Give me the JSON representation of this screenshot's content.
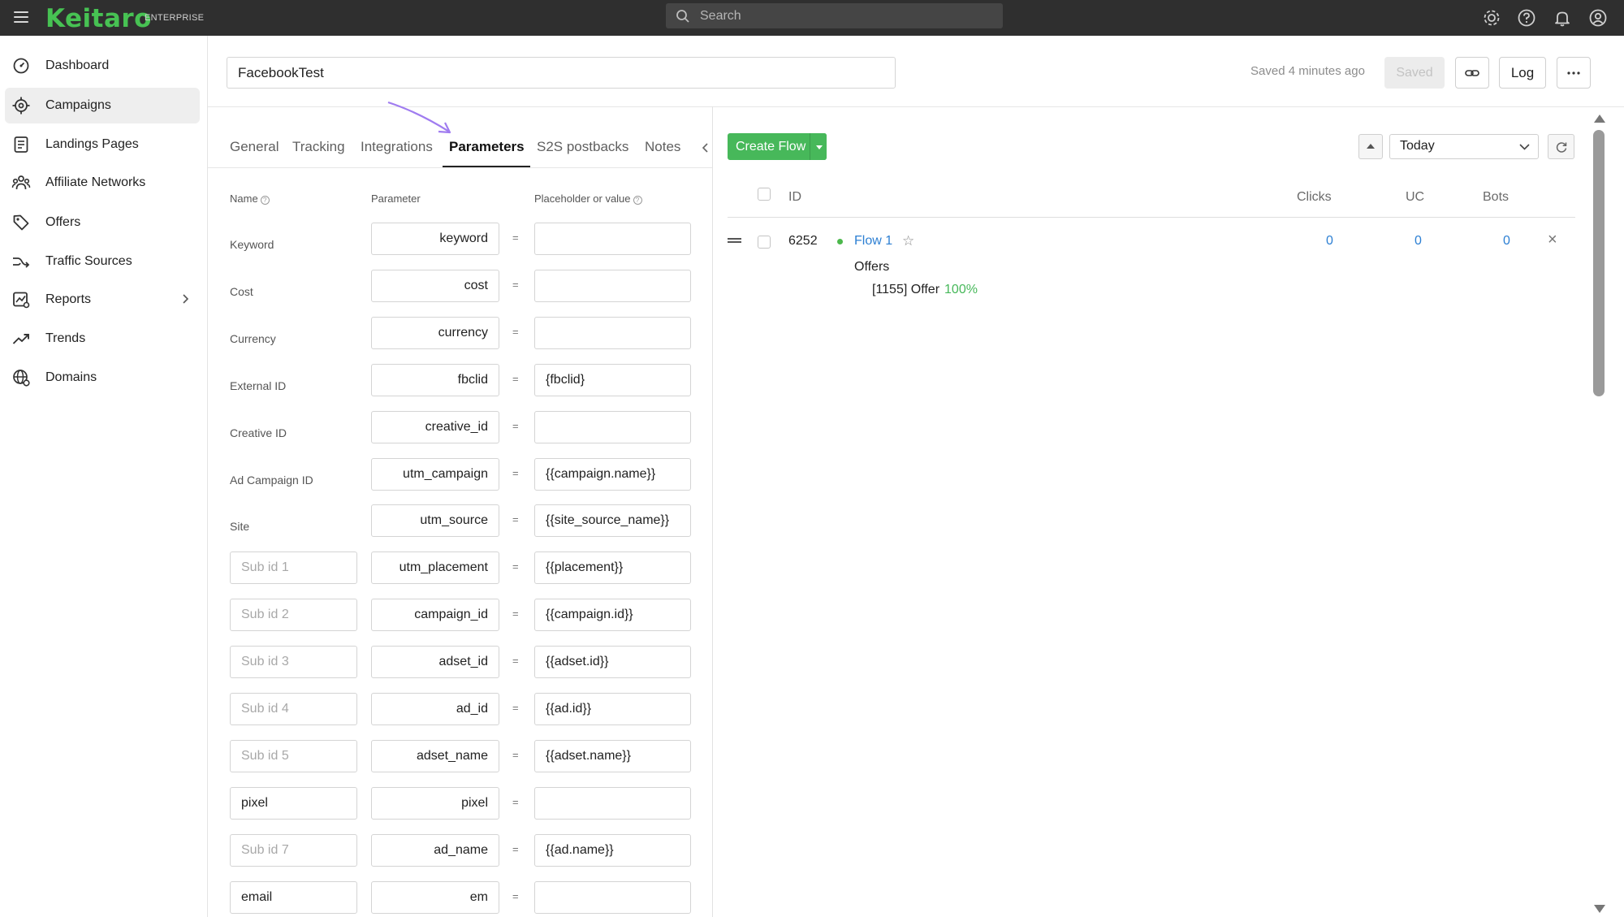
{
  "app": {
    "brand": "Keitaro",
    "edition": "ENTERPRISE",
    "search_placeholder": "Search",
    "accent_color": "#47c253"
  },
  "sidebar": {
    "items": [
      {
        "label": "Dashboard",
        "icon": "dashboard-icon"
      },
      {
        "label": "Campaigns",
        "icon": "target-icon",
        "active": true
      },
      {
        "label": "Landings Pages",
        "icon": "document-icon"
      },
      {
        "label": "Affiliate Networks",
        "icon": "network-icon"
      },
      {
        "label": "Offers",
        "icon": "tag-icon"
      },
      {
        "label": "Traffic Sources",
        "icon": "traffic-icon"
      },
      {
        "label": "Reports",
        "icon": "report-icon",
        "has_submenu": true
      },
      {
        "label": "Trends",
        "icon": "trend-icon"
      },
      {
        "label": "Domains",
        "icon": "globe-icon"
      }
    ]
  },
  "header": {
    "campaign_name": "FacebookTest",
    "saved_status": "Saved 4 minutes ago",
    "saved_button": "Saved",
    "log_button": "Log"
  },
  "tabs": {
    "items": [
      "General",
      "Tracking",
      "Integrations",
      "Parameters",
      "S2S postbacks",
      "Notes"
    ],
    "active": "Parameters"
  },
  "params_table": {
    "headers": {
      "name": "Name",
      "parameter": "Parameter",
      "value": "Placeholder or value"
    },
    "rows": [
      {
        "name": "Keyword",
        "name_editable": false,
        "parameter": "keyword",
        "value": ""
      },
      {
        "name": "Cost",
        "name_editable": false,
        "parameter": "cost",
        "value": ""
      },
      {
        "name": "Currency",
        "name_editable": false,
        "parameter": "currency",
        "value": ""
      },
      {
        "name": "External ID",
        "name_editable": false,
        "parameter": "fbclid",
        "value": "{fbclid}"
      },
      {
        "name": "Creative ID",
        "name_editable": false,
        "parameter": "creative_id",
        "value": ""
      },
      {
        "name": "Ad Campaign ID",
        "name_editable": false,
        "parameter": "utm_campaign",
        "value": "{{campaign.name}}"
      },
      {
        "name": "Site",
        "name_editable": false,
        "parameter": "utm_source",
        "value": "{{site_source_name}}"
      },
      {
        "name": "",
        "name_placeholder": "Sub id 1",
        "name_editable": true,
        "parameter": "utm_placement",
        "value": "{{placement}}"
      },
      {
        "name": "",
        "name_placeholder": "Sub id 2",
        "name_editable": true,
        "parameter": "campaign_id",
        "value": "{{campaign.id}}"
      },
      {
        "name": "",
        "name_placeholder": "Sub id 3",
        "name_editable": true,
        "parameter": "adset_id",
        "value": "{{adset.id}}"
      },
      {
        "name": "",
        "name_placeholder": "Sub id 4",
        "name_editable": true,
        "parameter": "ad_id",
        "value": "{{ad.id}}"
      },
      {
        "name": "",
        "name_placeholder": "Sub id 5",
        "name_editable": true,
        "parameter": "adset_name",
        "value": "{{adset.name}}"
      },
      {
        "name": "pixel",
        "name_placeholder": "",
        "name_editable": true,
        "parameter": "pixel",
        "value": ""
      },
      {
        "name": "",
        "name_placeholder": "Sub id 7",
        "name_editable": true,
        "parameter": "ad_name",
        "value": "{{ad.name}}"
      },
      {
        "name": "email",
        "name_placeholder": "",
        "name_editable": true,
        "parameter": "em",
        "value": ""
      }
    ],
    "equals": "="
  },
  "flows": {
    "create_button": "Create Flow",
    "period": "Today",
    "columns": [
      "ID",
      "Clicks",
      "UC",
      "Bots"
    ],
    "rows": [
      {
        "id": "6252",
        "name": "Flow 1",
        "clicks": "0",
        "uc": "0",
        "bots": "0",
        "status_color": "#4cb84c",
        "offers_label": "Offers",
        "offer": "[1155] Offer",
        "offer_share": "100%"
      }
    ]
  }
}
